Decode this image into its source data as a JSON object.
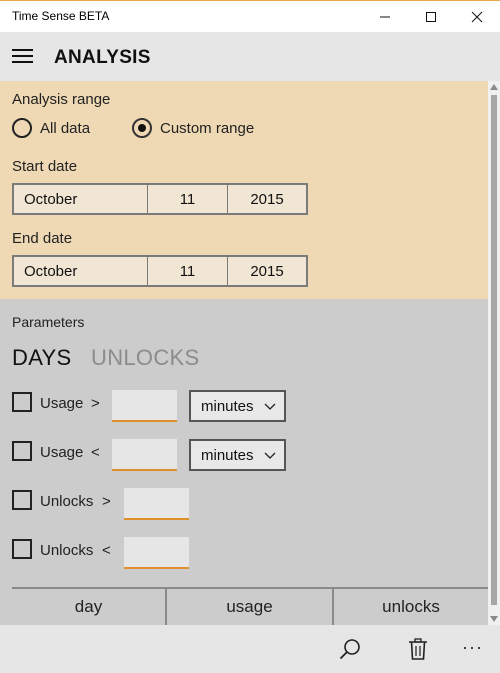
{
  "window": {
    "title": "Time Sense BETA"
  },
  "header": {
    "title": "ANALYSIS"
  },
  "analysis_range": {
    "label": "Analysis range",
    "options": [
      {
        "label": "All data",
        "selected": false
      },
      {
        "label": "Custom range",
        "selected": true
      }
    ]
  },
  "start_date": {
    "label": "Start date",
    "month": "October",
    "day": "11",
    "year": "2015"
  },
  "end_date": {
    "label": "End date",
    "month": "October",
    "day": "11",
    "year": "2015"
  },
  "parameters": {
    "label": "Parameters",
    "tabs": [
      {
        "label": "DAYS",
        "active": true
      },
      {
        "label": "UNLOCKS",
        "active": false
      }
    ],
    "filters": [
      {
        "label": "Usage",
        "operator": ">",
        "value": "",
        "unit": "minutes"
      },
      {
        "label": "Usage",
        "operator": "<",
        "value": "",
        "unit": "minutes"
      },
      {
        "label": "Unlocks",
        "operator": ">",
        "value": ""
      },
      {
        "label": "Unlocks",
        "operator": "<",
        "value": ""
      }
    ]
  },
  "table": {
    "columns": [
      "day",
      "usage",
      "unlocks"
    ]
  },
  "command_bar": {
    "more": "···"
  },
  "icons": {
    "menu": "hamburger-icon",
    "search": "search-icon",
    "delete": "trash-icon",
    "more": "more-icon"
  },
  "colors": {
    "range_panel": "#efd9b4",
    "params_panel": "#cccccc",
    "accent": "#e0902b"
  }
}
